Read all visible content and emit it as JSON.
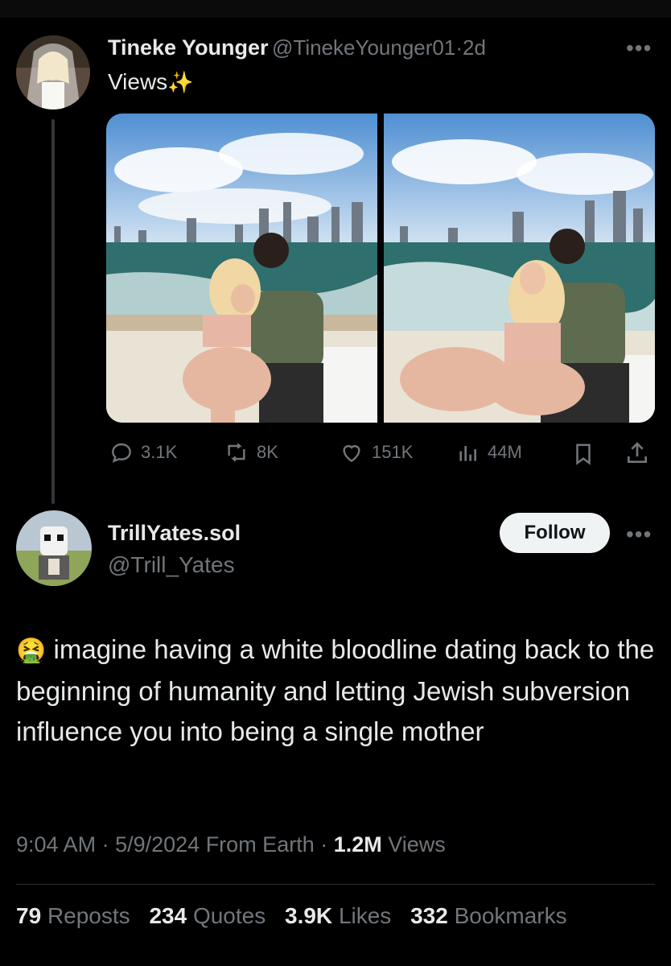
{
  "original_tweet": {
    "display_name": "Tineke Younger",
    "handle": "@TinekeYounger01",
    "separator": "·",
    "age": "2d",
    "text": "Views",
    "sparkle_icon": "✨",
    "metrics": {
      "replies": "3.1K",
      "reposts": "8K",
      "likes": "151K",
      "views": "44M"
    }
  },
  "reply_tweet": {
    "display_name": "TrillYates.sol",
    "handle": "@Trill_Yates",
    "follow_label": "Follow",
    "emoji": "🤮",
    "text": "imagine having a white bloodline dating back to the beginning of humanity and letting Jewish subversion  influence you into being a single mother",
    "meta": {
      "time": "9:04 AM",
      "date": "5/9/2024",
      "source": "From Earth",
      "views_count": "1.2M",
      "views_label": "Views"
    },
    "stats": {
      "reposts_count": "79",
      "reposts_label": "Reposts",
      "quotes_count": "234",
      "quotes_label": "Quotes",
      "likes_count": "3.9K",
      "likes_label": "Likes",
      "bookmarks_count": "332",
      "bookmarks_label": "Bookmarks"
    }
  },
  "colors": {
    "background": "#000000",
    "text_primary": "#e7e9ea",
    "text_muted": "#71767b",
    "follow_button_bg": "#eff3f4",
    "divider": "#2f3336"
  }
}
